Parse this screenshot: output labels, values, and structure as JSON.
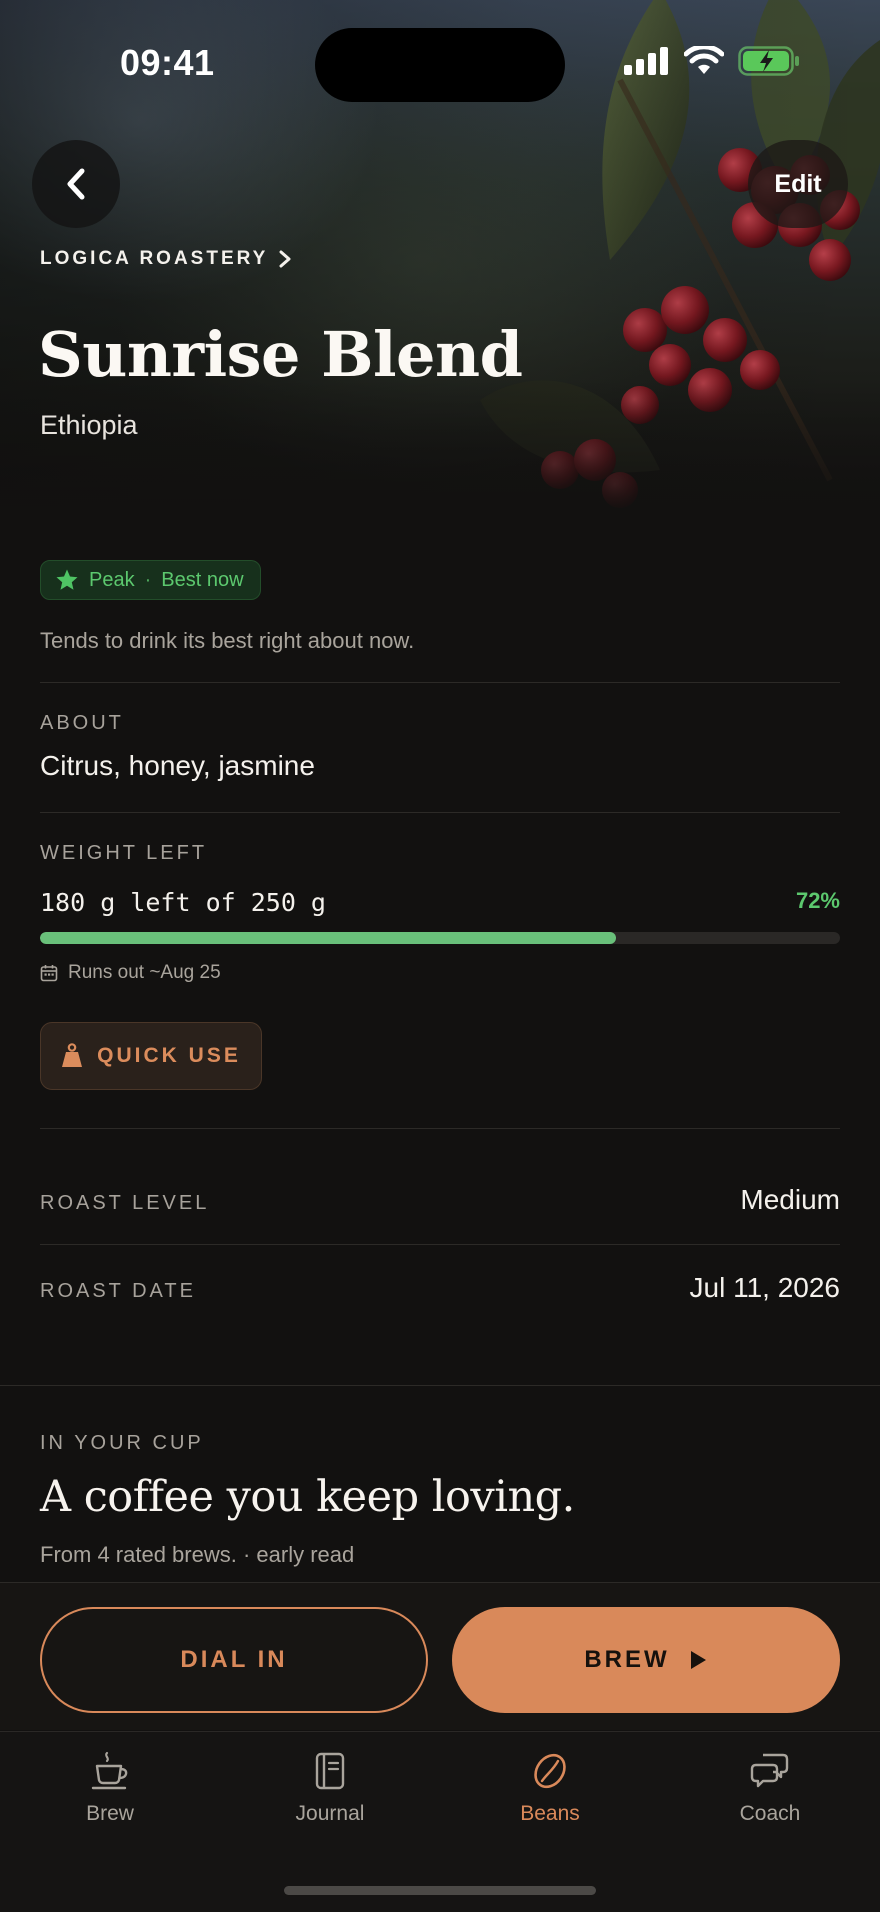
{
  "status_bar": {
    "time": "09:41"
  },
  "header": {
    "back_icon": "chevron-left-icon",
    "edit_label": "Edit"
  },
  "bean": {
    "roastery": "LOGICA ROASTERY",
    "name": "Sunrise Blend",
    "origin": "Ethiopia"
  },
  "peak": {
    "state": "Peak",
    "separator": "·",
    "note": "Best now",
    "description": "Tends to drink its best right about now.",
    "color": "#5cc86e"
  },
  "about": {
    "label": "ABOUT",
    "value": "Citrus, honey, jasmine"
  },
  "weight": {
    "label": "WEIGHT LEFT",
    "text": "180 g left of 250 g",
    "percent_label": "72%",
    "fraction_remaining": 0.72,
    "runs_out": "Runs out ~Aug 25",
    "quick_use_label": "QUICK USE"
  },
  "roast_level": {
    "label": "ROAST LEVEL",
    "value": "Medium"
  },
  "roast_date": {
    "label": "ROAST DATE",
    "value": "Jul 11, 2026"
  },
  "in_your_cup": {
    "label": "IN YOUR CUP",
    "headline": "A coffee you keep loving.",
    "subtitle": "From 4 rated brews. · early read"
  },
  "actions": {
    "dial_in_label": "DIAL IN",
    "brew_label": "BREW"
  },
  "tabs": [
    {
      "label": "Brew",
      "icon": "cup-icon",
      "active": false
    },
    {
      "label": "Journal",
      "icon": "journal-icon",
      "active": false
    },
    {
      "label": "Beans",
      "icon": "bean-icon",
      "active": true
    },
    {
      "label": "Coach",
      "icon": "chat-bubbles-icon",
      "active": false
    }
  ],
  "colors": {
    "accent": "#d9895a",
    "peak_green": "#5cc86e",
    "background": "#121110"
  }
}
